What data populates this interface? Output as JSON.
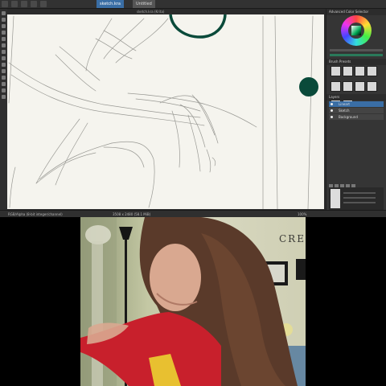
{
  "app": {
    "document_tab": "sketch.kra",
    "document_tab_2": "Untitled",
    "canvas_title": "sketch.kra (Krita)"
  },
  "dock": {
    "color_title": "Advanced Color Selector",
    "brush_title": "Brush Presets",
    "layers_title": "Layers",
    "layers": [
      {
        "label": "Lineart",
        "active": true
      },
      {
        "label": "Sketch",
        "active": false
      },
      {
        "label": "Background",
        "active": false
      }
    ]
  },
  "status": {
    "left": "RGB/Alpha (8-bit integer/channel)",
    "center": "3508 x 2480 (58.1 MiB)",
    "right": "100%"
  },
  "colors": {
    "ink": "#0a4a3a",
    "accent": "#3a6ea5"
  },
  "webcam": {
    "wall_text": "CRE"
  }
}
